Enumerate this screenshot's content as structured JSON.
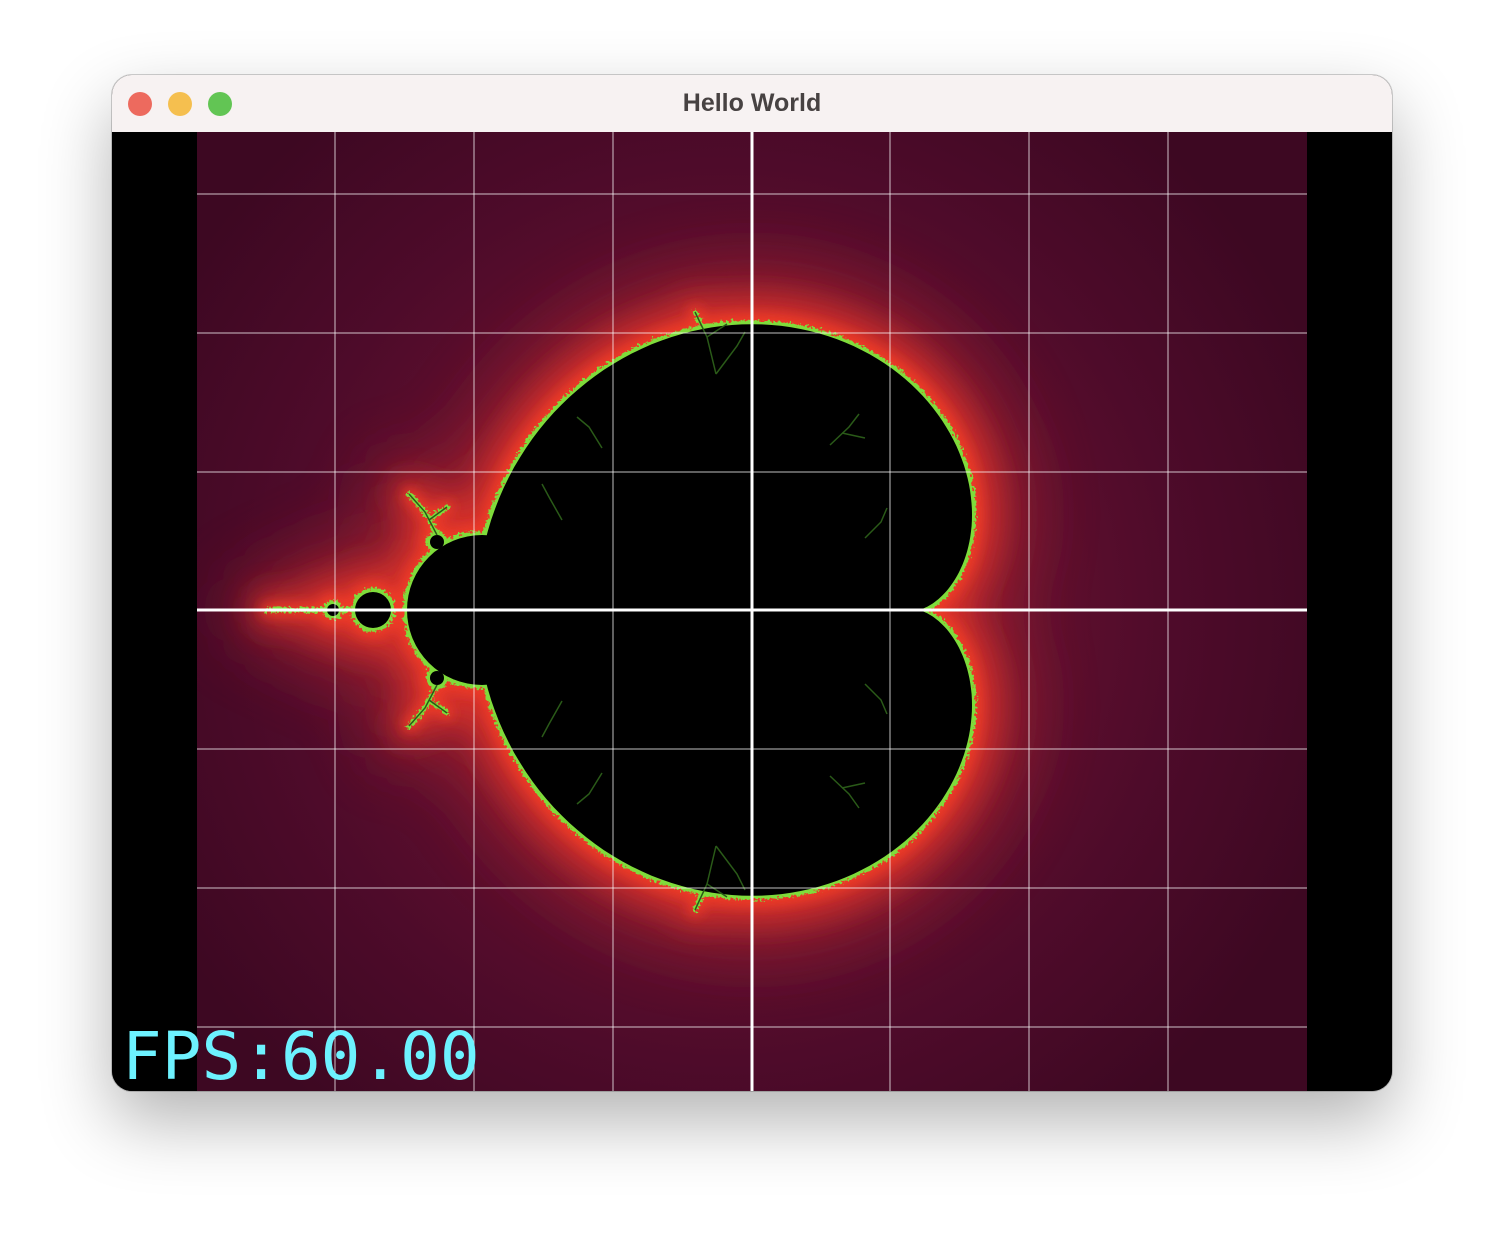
{
  "window": {
    "title": "Hello World",
    "controls": {
      "close_color": "#ed6a5e",
      "minimize_color": "#f5bf4f",
      "maximize_color": "#62c554"
    }
  },
  "render": {
    "fractal": "mandelbrot",
    "background_color": "#430a26",
    "glow_color": "#ee3a28",
    "edge_color": "#7fdc3a",
    "set_color": "#000000",
    "grid_color": "#ffffff"
  },
  "overlay": {
    "fps_text": "FPS:60.00",
    "fps_color": "#6df2ff"
  }
}
